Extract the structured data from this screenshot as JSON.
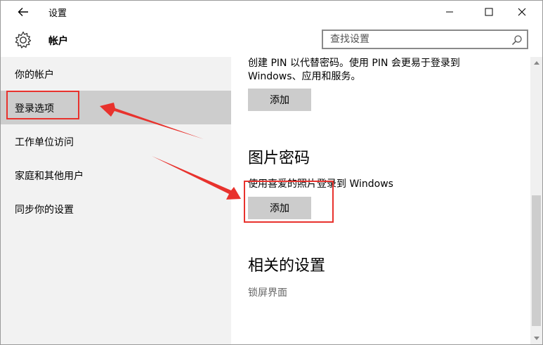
{
  "window": {
    "title": "设置",
    "controls": {
      "minimize_icon": "minimize-icon",
      "maximize_icon": "maximize-icon",
      "close_icon": "close-icon"
    }
  },
  "header": {
    "title": "帐户",
    "icon": "gear-icon"
  },
  "search": {
    "placeholder": "查找设置",
    "icon": "search-icon"
  },
  "sidebar": {
    "items": [
      {
        "label": "你的帐户"
      },
      {
        "label": "登录选项",
        "selected": true
      },
      {
        "label": "工作单位访问"
      },
      {
        "label": "家庭和其他用户"
      },
      {
        "label": "同步你的设置"
      }
    ]
  },
  "content": {
    "pin": {
      "desc_line1": "创建 PIN 以代替密码。使用 PIN 会更易于登录到",
      "desc_line2": "Windows、应用和服务。",
      "add_label": "添加"
    },
    "picture_password": {
      "title": "图片密码",
      "desc": "使用喜爱的照片登录到 Windows",
      "add_label": "添加"
    },
    "related": {
      "title": "相关的设置",
      "link": "锁屏界面"
    }
  },
  "colors": {
    "accent_annotation": "#e8322d",
    "selected_bg": "#cdcdcd",
    "sidebar_bg": "#f2f2f2",
    "button_bg": "#cccccc"
  }
}
